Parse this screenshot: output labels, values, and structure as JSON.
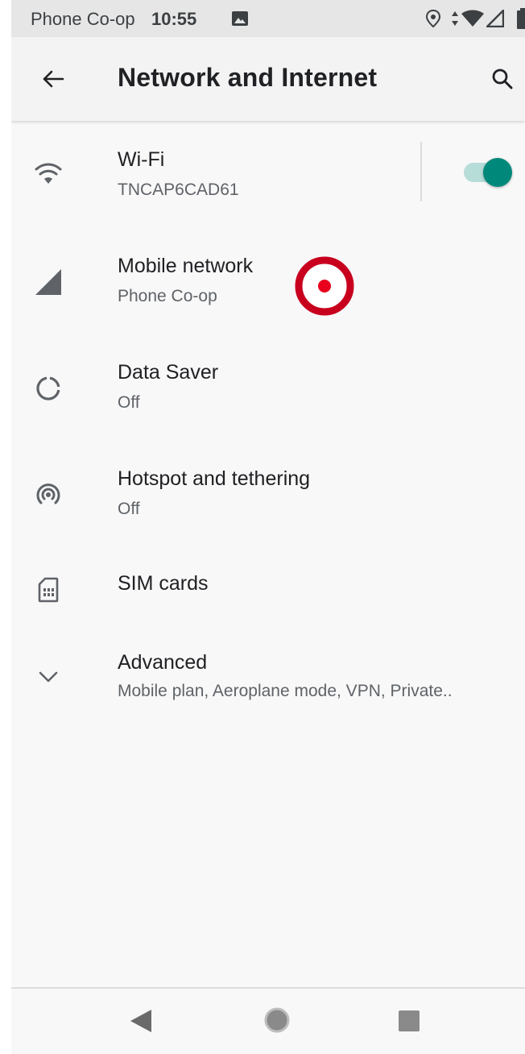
{
  "status_bar": {
    "carrier": "Phone Co-op",
    "time": "10:55",
    "icons": [
      "image-icon",
      "location-icon",
      "data-arrows-icon",
      "wifi-icon",
      "cell-signal-icon",
      "battery-icon"
    ]
  },
  "app_bar": {
    "title": "Network and Internet",
    "back_icon": "arrow-back-icon",
    "search_icon": "search-icon"
  },
  "settings": [
    {
      "id": "wifi",
      "label": "Wi-Fi",
      "summary": "TNCAP6CAD61",
      "icon": "wifi-icon",
      "toggle_on": true
    },
    {
      "id": "mobile-network",
      "label": "Mobile network",
      "summary": "Phone Co-op",
      "icon": "cell-signal-icon"
    },
    {
      "id": "data-saver",
      "label": "Data Saver",
      "summary": "Off",
      "icon": "data-saver-icon"
    },
    {
      "id": "hotspot",
      "label": "Hotspot and tethering",
      "summary": "Off",
      "icon": "hotspot-icon"
    },
    {
      "id": "sim-cards",
      "label": "SIM cards",
      "summary": "",
      "icon": "sim-card-icon"
    },
    {
      "id": "advanced",
      "label": "Advanced",
      "summary": "Mobile plan, Aeroplane mode, VPN, Private..",
      "icon": "chevron-down-icon"
    }
  ],
  "colors": {
    "accent": "#00897b",
    "toggle_track": "#b7ddd8",
    "tap_marker": "#c8001e"
  },
  "nav_bar": {
    "icons": [
      "nav-back-icon",
      "nav-home-icon",
      "nav-recents-icon"
    ]
  }
}
